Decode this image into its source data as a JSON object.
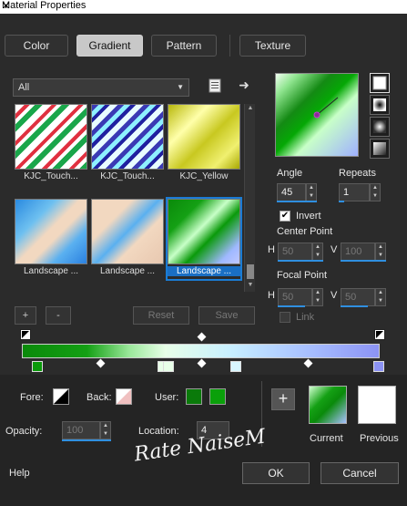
{
  "window": {
    "title": "Material Properties",
    "close": "✕"
  },
  "tabs": [
    {
      "label": "Color"
    },
    {
      "label": "Gradient",
      "active": true
    },
    {
      "label": "Pattern"
    },
    {
      "label": "Texture"
    }
  ],
  "filter": {
    "value": "All"
  },
  "gallery": {
    "items": [
      {
        "label": "KJC_Touch..."
      },
      {
        "label": "KJC_Touch..."
      },
      {
        "label": "KJC_Yellow"
      },
      {
        "label": "Landscape ..."
      },
      {
        "label": "Landscape ..."
      },
      {
        "label": "Landscape ...",
        "selected": true
      }
    ]
  },
  "gallery_buttons": {
    "add": "+",
    "remove": "-",
    "reset": "Reset",
    "save": "Save"
  },
  "settings": {
    "angle_label": "Angle",
    "angle_value": "45",
    "repeats_label": "Repeats",
    "repeats_value": "1",
    "invert_label": "Invert",
    "invert_checked": true,
    "center_point_label": "Center Point",
    "center_h_label": "H",
    "center_h_value": "50",
    "center_v_label": "V",
    "center_v_value": "100",
    "focal_point_label": "Focal Point",
    "focal_h_label": "H",
    "focal_h_value": "50",
    "focal_v_label": "V",
    "focal_v_value": "50",
    "link_label": "Link"
  },
  "stops": {
    "fore_label": "Fore:",
    "back_label": "Back:",
    "user_label": "User:",
    "opacity_label": "Opacity:",
    "opacity_value": "100",
    "location_label": "Location:",
    "location_value": "4"
  },
  "colors": {
    "user_color_1": "#0a7a0a",
    "user_color_2": "#0aa00a",
    "accent": "#1a7cd4"
  },
  "current": {
    "label": "Current"
  },
  "previous": {
    "label": "Previous"
  },
  "add_swatch": "+",
  "watermark": "Rate NaiseM",
  "footer": {
    "help": "Help",
    "ok": "OK",
    "cancel": "Cancel"
  }
}
